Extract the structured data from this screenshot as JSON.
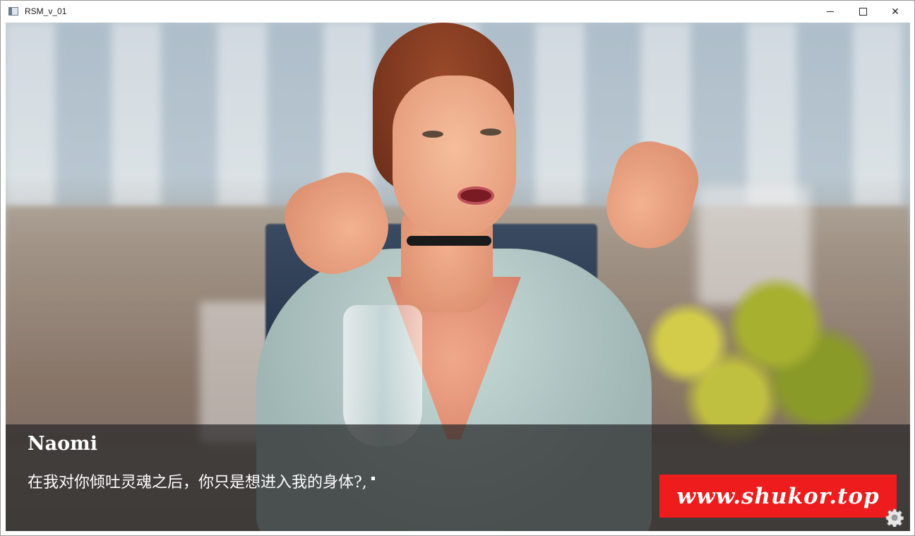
{
  "window": {
    "title": "RSM_v_01",
    "controls": {
      "minimize": "minimize-icon",
      "maximize": "maximize-icon",
      "close": "close-icon",
      "close_glyph": "✕"
    }
  },
  "dialogue": {
    "speaker": "Naomi",
    "text": "在我对你倾吐灵魂之后，你只是想进入我的身体?,"
  },
  "watermark": {
    "text": "www.shukor.top",
    "color": "#ee1c1c"
  },
  "overlay": {
    "settings_icon": "gear-icon"
  }
}
